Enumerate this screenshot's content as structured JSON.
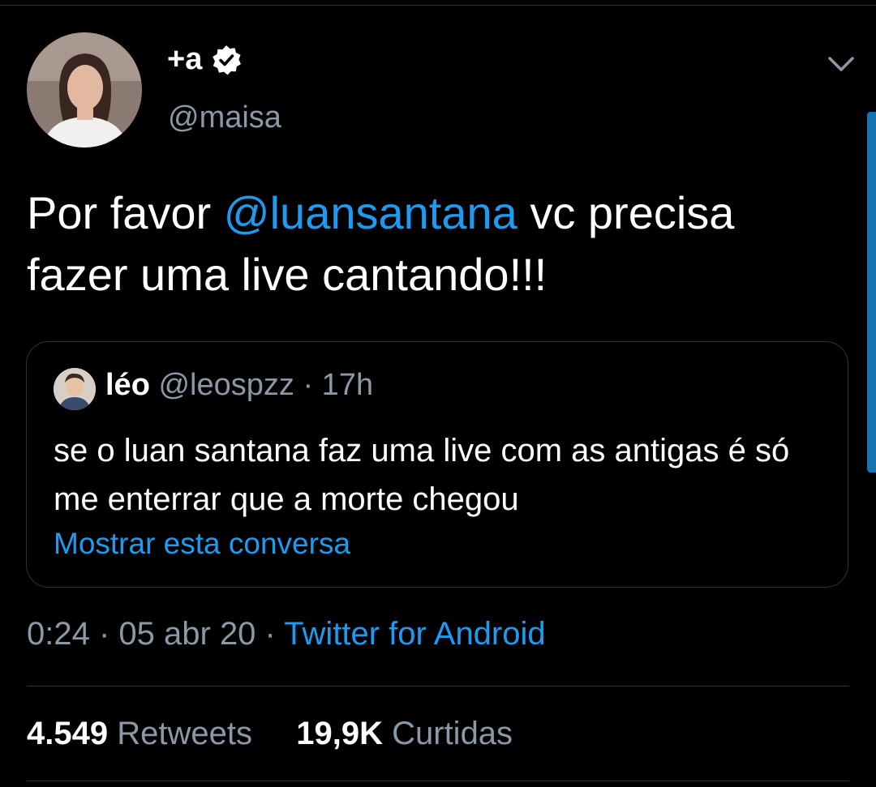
{
  "author": {
    "display_name": "+a",
    "handle": "@maisa",
    "verified": true
  },
  "tweet": {
    "text_before": "Por favor ",
    "mention": "@luansantana",
    "text_after": " vc precisa fazer uma live cantando!!!"
  },
  "quoted_tweet": {
    "name": "léo",
    "handle": "@leospzz",
    "separator": " · ",
    "time": "17h",
    "text": "se o luan santana faz uma live com as antigas é só me enterrar que a morte chegou",
    "show_thread": "Mostrar esta conversa"
  },
  "meta": {
    "time": "0:24",
    "sep1": " · ",
    "date": "05 abr 20",
    "sep2": " · ",
    "source": "Twitter for Android"
  },
  "stats": {
    "retweets_count": "4.549",
    "retweets_label": "Retweets",
    "likes_count": "19,9K",
    "likes_label": "Curtidas"
  },
  "icons": {
    "verified": "verified-badge-icon",
    "more": "chevron-down-icon"
  },
  "colors": {
    "background": "#000000",
    "accent": "#1d9bf0",
    "secondary_text": "#8b98a5",
    "border": "#2f3336"
  }
}
